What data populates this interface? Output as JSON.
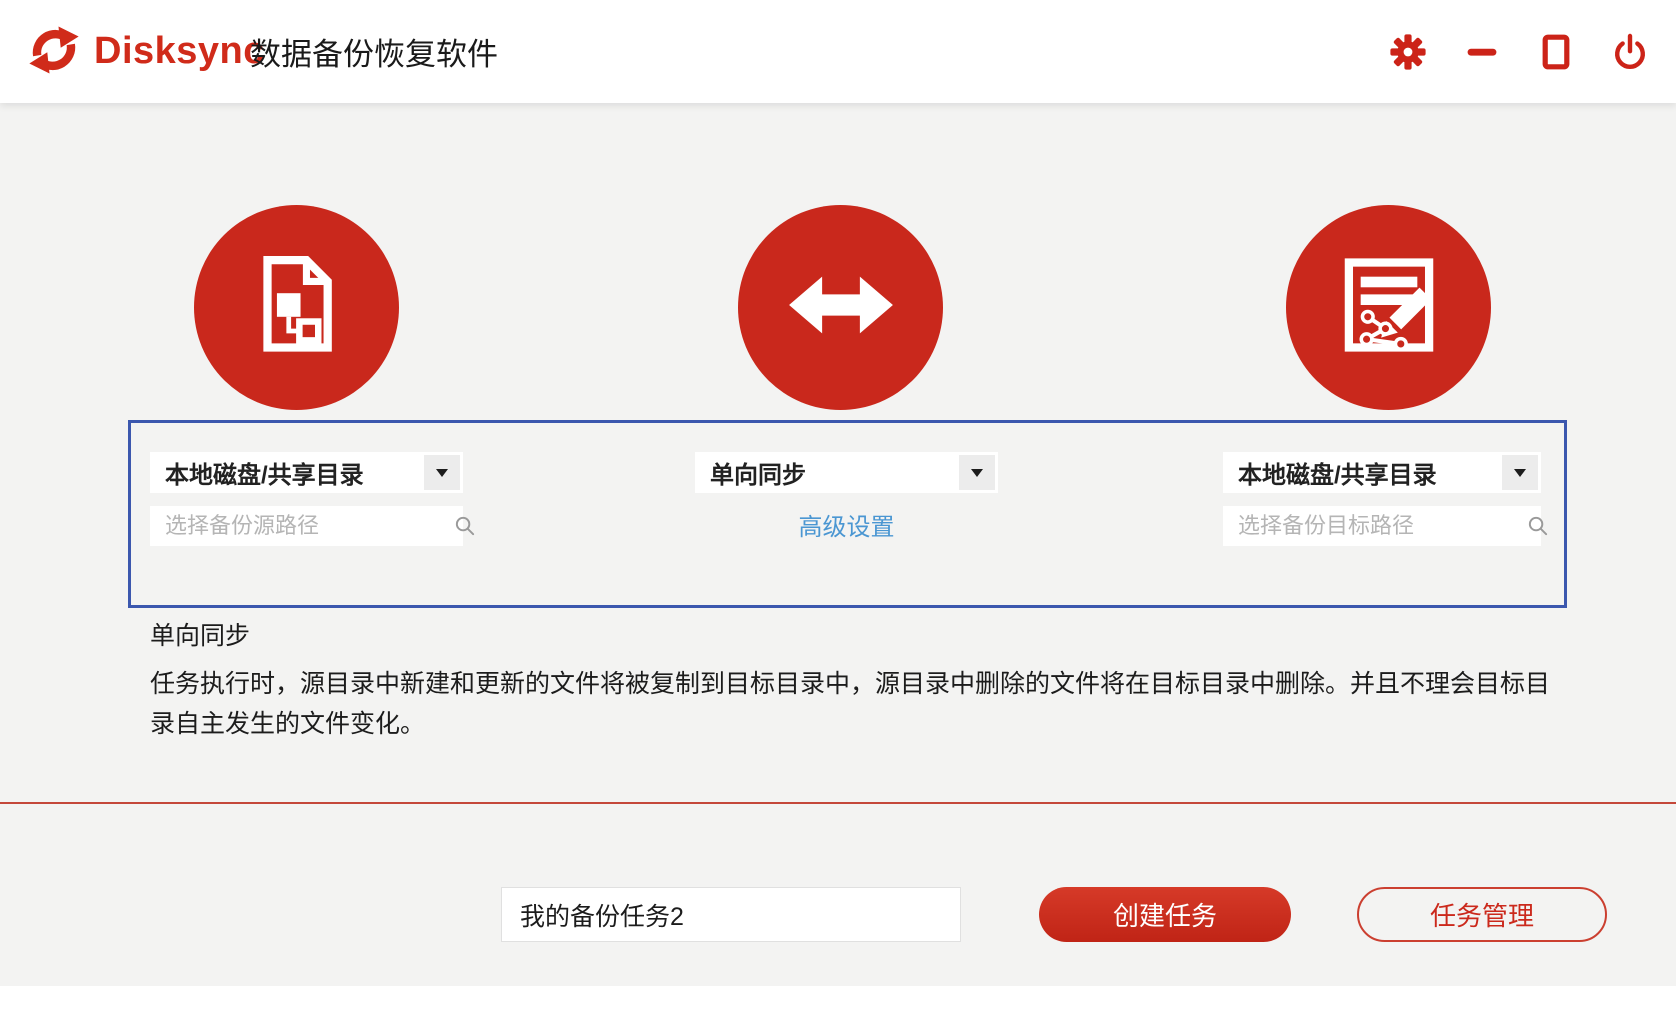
{
  "header": {
    "brand": "Disksync",
    "title": "数据备份恢复软件"
  },
  "panel": {
    "source": {
      "type_value": "本地磁盘/共享目录",
      "path_placeholder": "选择备份源路径",
      "icon": "document-flowchart"
    },
    "sync": {
      "mode_value": "单向同步",
      "advanced_link": "高级设置",
      "icon": "double-arrow"
    },
    "target": {
      "type_value": "本地磁盘/共享目录",
      "path_placeholder": "选择备份目标路径",
      "icon": "document-edit"
    }
  },
  "description": {
    "heading": "单向同步",
    "body": "任务执行时，源目录中新建和更新的文件将被复制到目标目录中，源目录中删除的文件将在目标目录中删除。并且不理会目标目录自主发生的文件变化。"
  },
  "footer": {
    "task_name_value": "我的备份任务2",
    "create_button": "创建任务",
    "manage_button": "任务管理"
  },
  "icons": {
    "window_controls": [
      "gear",
      "minimize",
      "maximize",
      "power"
    ],
    "search": "magnifier",
    "dropdown": "caret-down"
  },
  "colors": {
    "primary_red": "#cb291c",
    "circle_red": "#c9281c",
    "logo_red": "#d02b1a",
    "panel_border_blue": "#3b57ae",
    "link_blue": "#4a96d2",
    "page_background": "#f3f3f2",
    "header_background": "#ffffff"
  }
}
